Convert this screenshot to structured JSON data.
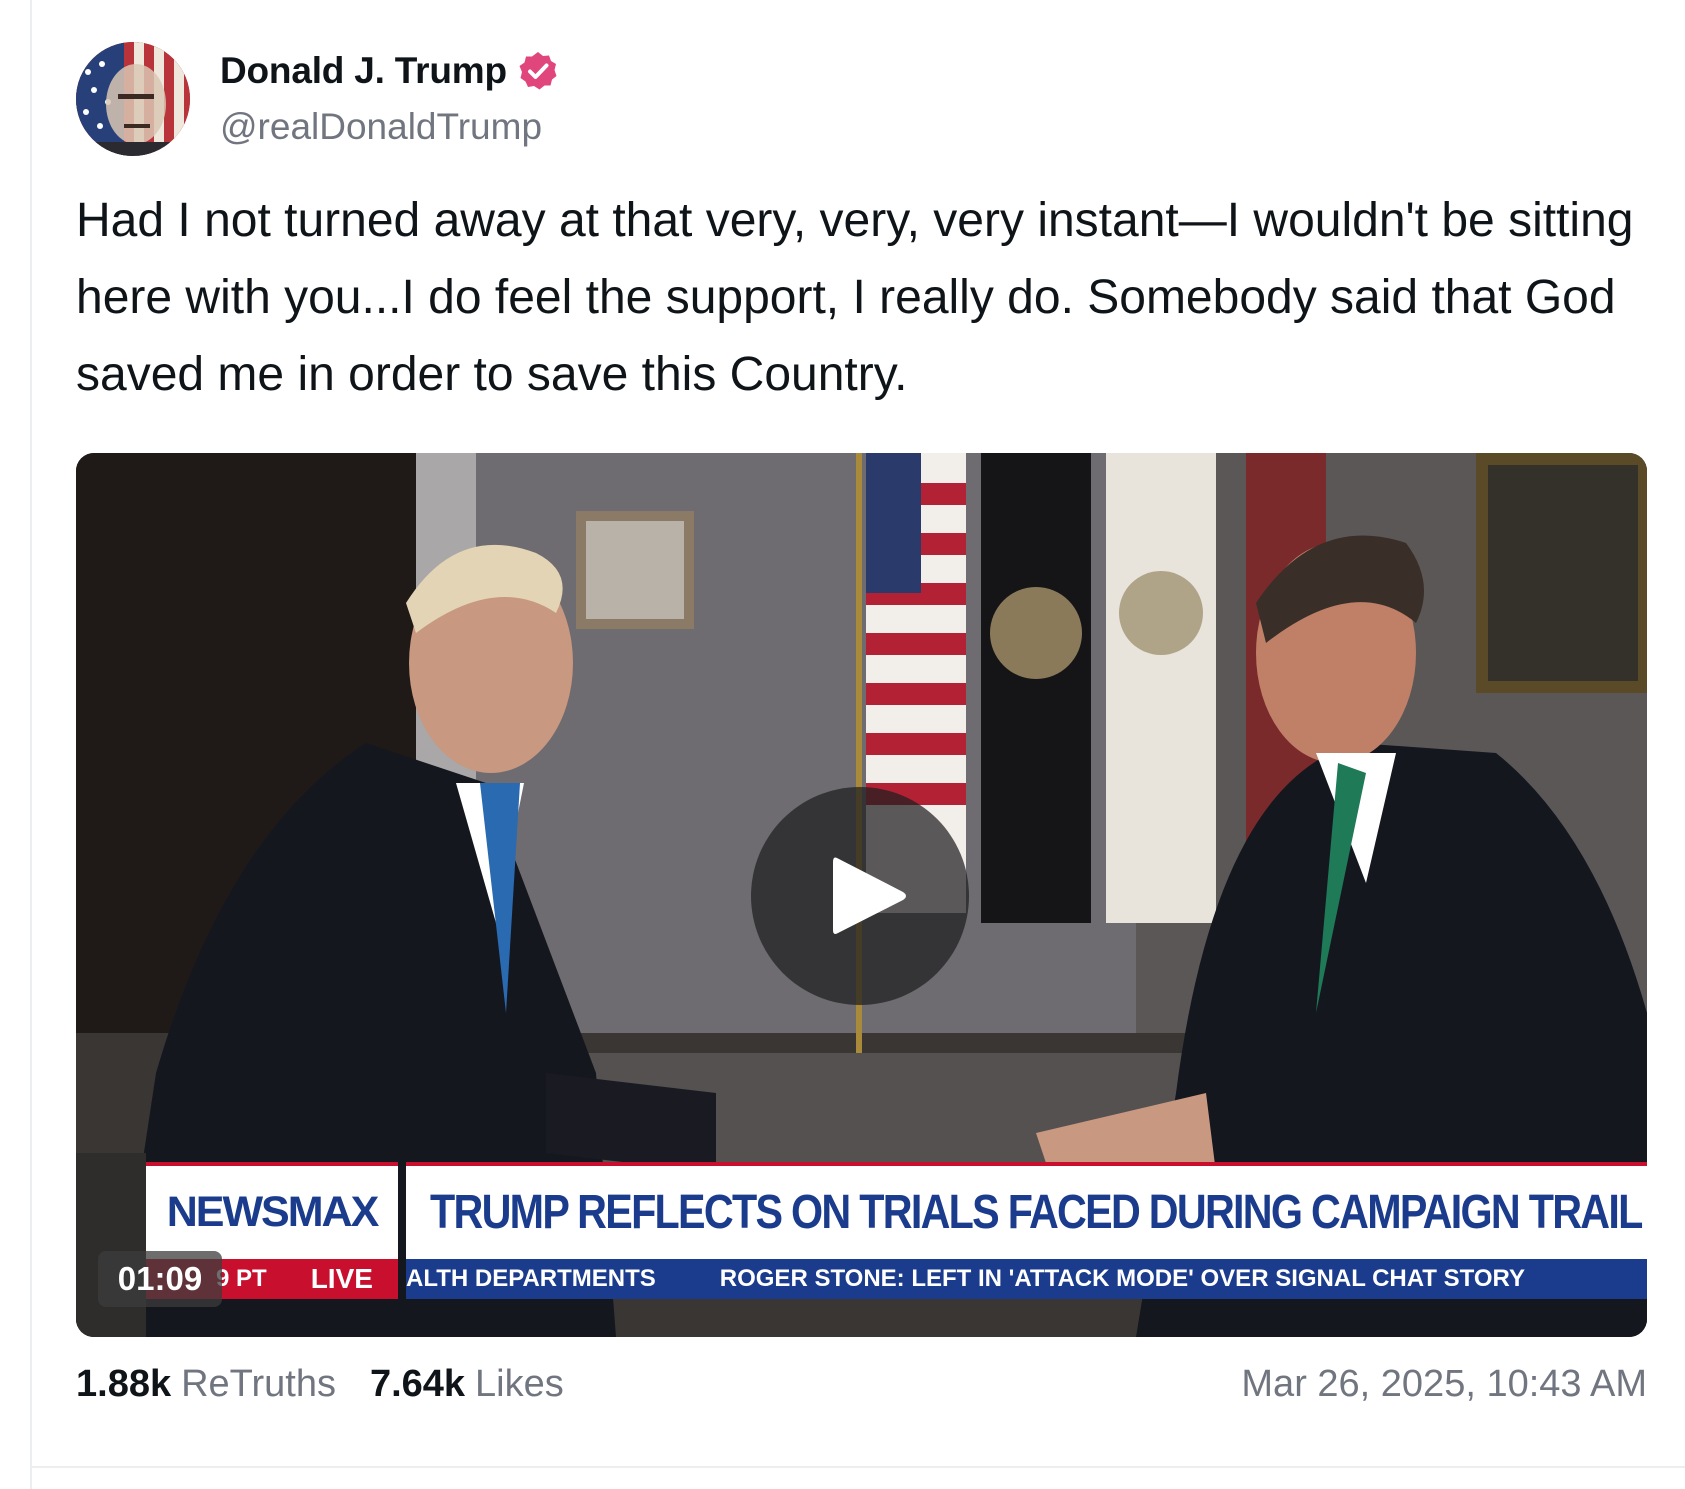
{
  "author": {
    "display_name": "Donald J. Trump",
    "handle": "@realDonaldTrump",
    "verified": true,
    "verified_color": "#e0457b"
  },
  "post": {
    "text": "Had I not turned away at that very, very, very instant—I wouldn't be sitting here with you...I do feel the support, I really do. Somebody said that God saved me in order to save this Country."
  },
  "video": {
    "duration": "01:09",
    "play_icon": "play-icon",
    "lower_third": {
      "brand": "NEWSMAX",
      "headline": "TRUMP REFLECTS ON TRIALS FACED DURING CAMPAIGN TRAIL",
      "ticker_time": "9 PT",
      "ticker_live": "LIVE",
      "ticker_items": [
        "ALTH DEPARTMENTS",
        "ROGER STONE:  LEFT IN 'ATTACK MODE' OVER SIGNAL CHAT STORY"
      ]
    }
  },
  "stats": {
    "retruths_count": "1.88k",
    "retruths_label": "ReTruths",
    "likes_count": "7.64k",
    "likes_label": "Likes"
  },
  "timestamp": "Mar 26, 2025, 10:43 AM",
  "colors": {
    "text_primary": "#0f1419",
    "text_secondary": "#70757f",
    "newsmax_blue": "#1b3c8c",
    "newsmax_red": "#c8102e"
  }
}
